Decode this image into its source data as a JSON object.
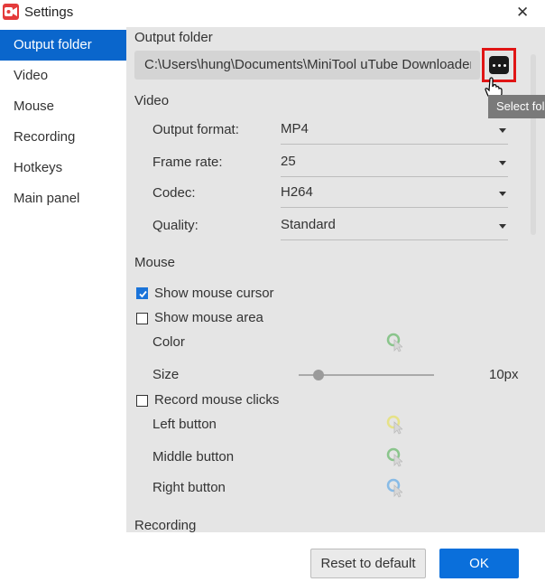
{
  "window": {
    "title": "Settings",
    "close_label": "✕"
  },
  "sidebar": {
    "items": [
      {
        "label": "Output folder",
        "active": true
      },
      {
        "label": "Video"
      },
      {
        "label": "Mouse"
      },
      {
        "label": "Recording"
      },
      {
        "label": "Hotkeys"
      },
      {
        "label": "Main panel"
      }
    ]
  },
  "output_folder": {
    "heading": "Output folder",
    "path": "C:\\Users\\hung\\Documents\\MiniTool uTube Downloader",
    "browse_tooltip": "Select folder"
  },
  "video": {
    "heading": "Video",
    "output_format": {
      "label": "Output format:",
      "value": "MP4"
    },
    "frame_rate": {
      "label": "Frame rate:",
      "value": "25"
    },
    "codec": {
      "label": "Codec:",
      "value": "H264"
    },
    "quality": {
      "label": "Quality:",
      "value": "Standard"
    }
  },
  "mouse": {
    "heading": "Mouse",
    "show_cursor": {
      "label": "Show mouse cursor",
      "checked": true
    },
    "show_area": {
      "label": "Show mouse area",
      "checked": false
    },
    "color_label": "Color",
    "size_label": "Size",
    "size_value": "10px",
    "size_level": 0.1,
    "record_clicks": {
      "label": "Record mouse clicks",
      "checked": false
    },
    "left_button_label": "Left button",
    "middle_button_label": "Middle button",
    "right_button_label": "Right button",
    "colors": {
      "area": "#4caf50",
      "left": "#e6e04a",
      "middle": "#4caf50",
      "right": "#4a9ee6"
    }
  },
  "recording": {
    "heading": "Recording"
  },
  "footer": {
    "reset_label": "Reset to default",
    "ok_label": "OK"
  },
  "colors": {
    "accent": "#0a66cc",
    "highlight_border": "#e01515"
  }
}
